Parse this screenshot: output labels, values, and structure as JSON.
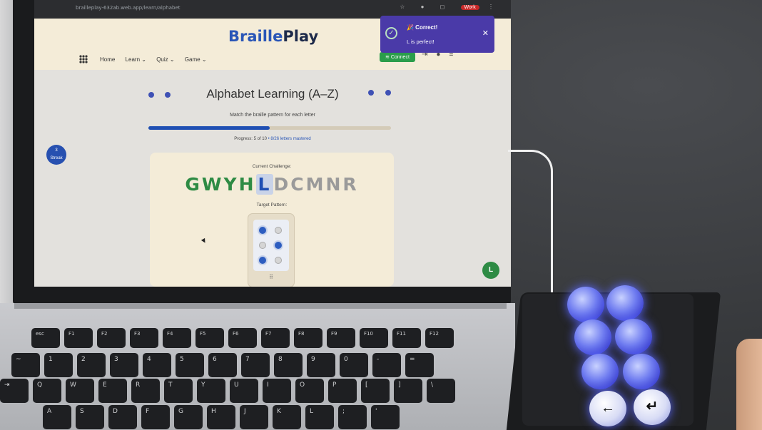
{
  "browser": {
    "url": "brailleplay-632ab.web.app/learn/alphabet",
    "profile_badge": "Work"
  },
  "app": {
    "logo_part1": "Braille",
    "logo_part2": "Play",
    "nav": [
      "Home",
      "Learn ⌄",
      "Quiz ⌄",
      "Game ⌄"
    ],
    "connect_label": "Connect",
    "colors": {
      "accent": "#2a56b7",
      "success": "#2e8b44",
      "toast": "#4a3aa8"
    }
  },
  "lesson": {
    "title": "Alphabet Learning (A–Z)",
    "subtitle": "Match the braille pattern for each letter",
    "progress_fraction": 0.5,
    "progress_label": "Progress: 5 of 10",
    "mastered_label": "• 8/26 letters mastered",
    "side_badge_value": "3",
    "side_badge_label": "Streak",
    "current_challenge_label": "Current Challenge:",
    "letters_done": [
      "G",
      "W",
      "Y",
      "H"
    ],
    "letter_current": "L",
    "letters_todo": [
      "D",
      "C",
      "M",
      "N",
      "R"
    ],
    "target_pattern_label": "Target Pattern:",
    "braille_dots": [
      true,
      false,
      true,
      false,
      true,
      false
    ],
    "drag_handle": "⠿",
    "fab_label": "L"
  },
  "toast": {
    "title": "🎉 Correct!",
    "message": "L is perfect!",
    "close": "✕"
  },
  "keyboard": {
    "row1": [
      "esc",
      "F1",
      "F2",
      "F3",
      "F4",
      "F5",
      "F6",
      "F7",
      "F8",
      "F9",
      "F10",
      "F11",
      "F12"
    ],
    "row2": [
      "~",
      "1",
      "2",
      "3",
      "4",
      "5",
      "6",
      "7",
      "8",
      "9",
      "0",
      "-",
      "="
    ],
    "row3": [
      "⇥",
      "Q",
      "W",
      "E",
      "R",
      "T",
      "Y",
      "U",
      "I",
      "O",
      "P",
      "[",
      "]",
      "\\"
    ],
    "row4": [
      "A",
      "S",
      "D",
      "F",
      "G",
      "H",
      "J",
      "K",
      "L",
      ";",
      "'"
    ]
  },
  "device": {
    "back_symbol": "←",
    "enter_symbol": "↵"
  }
}
